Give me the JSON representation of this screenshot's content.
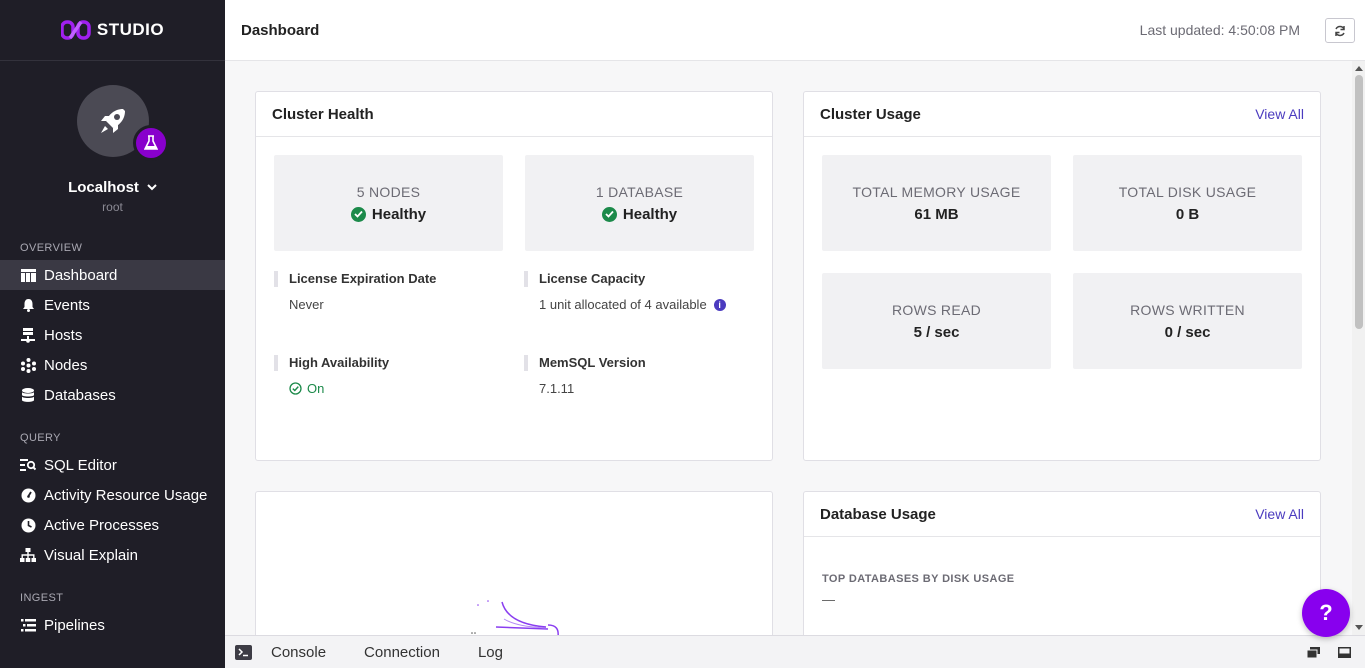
{
  "app": {
    "brand": "STUDIO",
    "accent_color": "#8800cc"
  },
  "sidebar": {
    "host_name": "Localhost",
    "host_user": "root",
    "sections": [
      {
        "label": "OVERVIEW",
        "items": [
          {
            "label": "Dashboard",
            "icon": "dashboard-icon",
            "active": true
          },
          {
            "label": "Events",
            "icon": "bell-icon"
          },
          {
            "label": "Hosts",
            "icon": "hosts-icon"
          },
          {
            "label": "Nodes",
            "icon": "nodes-icon"
          },
          {
            "label": "Databases",
            "icon": "database-icon"
          }
        ]
      },
      {
        "label": "QUERY",
        "items": [
          {
            "label": "SQL Editor",
            "icon": "sql-editor-icon"
          },
          {
            "label": "Activity Resource Usage",
            "icon": "activity-icon"
          },
          {
            "label": "Active Processes",
            "icon": "clock-icon"
          },
          {
            "label": "Visual Explain",
            "icon": "sitemap-icon"
          }
        ]
      },
      {
        "label": "INGEST",
        "items": [
          {
            "label": "Pipelines",
            "icon": "pipelines-icon"
          }
        ]
      }
    ]
  },
  "header": {
    "title": "Dashboard",
    "last_updated": "Last updated: 4:50:08 PM"
  },
  "cluster_health": {
    "title": "Cluster Health",
    "tiles": [
      {
        "label": "5 NODES",
        "status": "Healthy"
      },
      {
        "label": "1 DATABASE",
        "status": "Healthy"
      }
    ],
    "props": [
      {
        "label": "License Expiration Date",
        "value": "Never"
      },
      {
        "label": "License Capacity",
        "value": "1 unit allocated of 4 available"
      },
      {
        "label": "High Availability",
        "value": "On"
      },
      {
        "label": "MemSQL Version",
        "value": "7.1.11"
      }
    ]
  },
  "cluster_usage": {
    "title": "Cluster Usage",
    "view_all": "View All",
    "tiles": [
      {
        "label": "TOTAL MEMORY USAGE",
        "value": "61 MB"
      },
      {
        "label": "TOTAL DISK USAGE",
        "value": "0 B"
      },
      {
        "label": "ROWS READ",
        "value": "5 / sec"
      },
      {
        "label": "ROWS WRITTEN",
        "value": "0 / sec"
      }
    ]
  },
  "database_usage": {
    "title": "Database Usage",
    "view_all": "View All",
    "section_label": "TOP DATABASES BY DISK USAGE",
    "empty_value": "—"
  },
  "bottom_bar": {
    "tabs": [
      "Console",
      "Connection",
      "Log"
    ]
  },
  "help": {
    "label": "?"
  }
}
